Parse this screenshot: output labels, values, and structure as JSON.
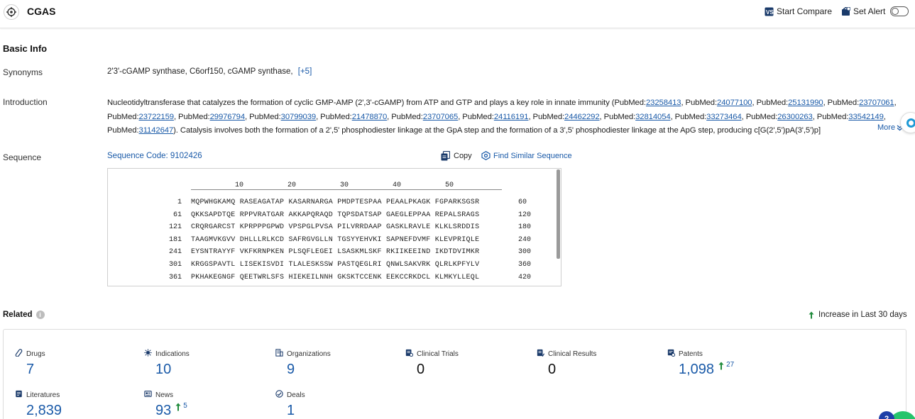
{
  "header": {
    "title": "CGAS",
    "start_compare": "Start Compare",
    "set_alert": "Set Alert"
  },
  "basic_info": {
    "heading": "Basic Info",
    "synonyms_label": "Synonyms",
    "synonyms": "2'3'-cGAMP synthase,  C6orf150,  cGAMP synthase,",
    "synonyms_more": "[+5]",
    "introduction_label": "Introduction",
    "intro": {
      "text1": "Nucleotidyltransferase that catalyzes the formation of cyclic GMP-AMP (2',3'-cGAMP) from ATP and GTP and plays a key role in innate immunity (PubMed:",
      "refs": [
        "23258413",
        "24077100",
        "25131990",
        "23707061",
        "23722159",
        "29976794",
        "30799039",
        "21478870",
        "23707065",
        "24116191",
        "24462292",
        "32814054",
        "33273464",
        "26300263",
        "33542149",
        "31142647"
      ],
      "sep": ", PubMed:",
      "text2": "). Catalysis involves both the formation of a 2',5' phosphodiester linkage at the GpA step and the formation of a 3',5' phosphodiester linkage at the ApG step, producing c[G(2',5')pA(3',5')p]"
    },
    "more": "More",
    "sequence_label": "Sequence",
    "sequence_code": "Sequence Code: 9102426",
    "copy": "Copy",
    "find_similar": "Find Similar Sequence",
    "ruler": [
      "10",
      "20",
      "30",
      "40",
      "50"
    ],
    "rows": [
      {
        "start": "1",
        "seq": "MQPWHGKAMQ RASEAGATAP KASARNARGA PMDPTESPAA PEAALPKAGK FGPARKSGSR",
        "end": "60"
      },
      {
        "start": "61",
        "seq": "QKKSAPDTQE RPPVRATGAR AKKAPQRAQD TQPSDATSAP GAEGLEPPAA REPALSRAGS",
        "end": "120"
      },
      {
        "start": "121",
        "seq": "CRQRGARCST KPRPPPGPWD VPSPGLPVSA PILVRRDAAP GASKLRAVLE KLKLSRDDIS",
        "end": "180"
      },
      {
        "start": "181",
        "seq": "TAAGMVKGVV DHLLLRLKCD SAFRGVGLLN TGSYYEHVKI SAPNEFDVMF KLEVPRIQLE",
        "end": "240"
      },
      {
        "start": "241",
        "seq": "EYSNTRAYYF VKFKRNPKEN PLSQFLEGEI LSASKMLSKF RKIIKEEIND IKDTDVIMKR",
        "end": "300"
      },
      {
        "start": "301",
        "seq": "KRGGSPAVTL LISEKISVDI TLALESKSSW PASTQEGLRI QNWLSAKVRK QLRLKPFYLV",
        "end": "360"
      },
      {
        "start": "361",
        "seq": "PKHAKEGNGF QEETWRLSFS HIEKEILNNH GKSKTCCENK EEKCCRKDCL KLMKYLLEQL",
        "end": "420"
      }
    ]
  },
  "related": {
    "heading": "Related",
    "increase_note": "Increase in Last 30 days",
    "stats": [
      {
        "label": "Drugs",
        "value": "7",
        "icon": "pill-icon"
      },
      {
        "label": "Indications",
        "value": "10",
        "icon": "virus-icon"
      },
      {
        "label": "Organizations",
        "value": "9",
        "icon": "building-icon"
      },
      {
        "label": "Clinical Trials",
        "value": "0",
        "icon": "clinical-trials-icon"
      },
      {
        "label": "Clinical Results",
        "value": "0",
        "icon": "clinical-results-icon"
      },
      {
        "label": "Patents",
        "value": "1,098",
        "icon": "patent-icon",
        "increase": "27"
      },
      {
        "label": "Literatures",
        "value": "2,839",
        "icon": "literature-icon"
      },
      {
        "label": "News",
        "value": "93",
        "icon": "news-icon",
        "increase": "5"
      },
      {
        "label": "Deals",
        "value": "1",
        "icon": "deal-icon"
      }
    ]
  },
  "widgets": {
    "chat_badge": "2"
  },
  "colors": {
    "accent": "#1a5aa8",
    "increase": "#1e8a3a"
  }
}
